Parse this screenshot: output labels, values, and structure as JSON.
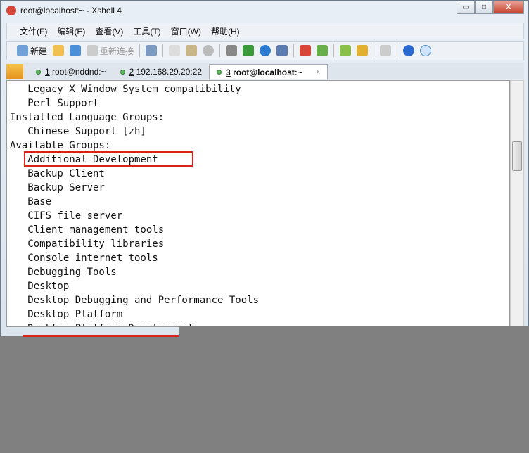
{
  "window": {
    "title": "root@localhost:~ - Xshell 4",
    "buttons": {
      "minimize": "▭",
      "maximize": "□",
      "close": "X"
    }
  },
  "menu": [
    "文件(F)",
    "编辑(E)",
    "查看(V)",
    "工具(T)",
    "窗口(W)",
    "帮助(H)"
  ],
  "toolbar": {
    "new_label": "新建",
    "reconnect_label": "重新连接"
  },
  "tabs": [
    {
      "num": "1",
      "label": " root@nddnd:~",
      "active": false
    },
    {
      "num": "2",
      "label": " 192.168.29.20:22",
      "active": false
    },
    {
      "num": "3",
      "label": " root@localhost:~",
      "active": true
    }
  ],
  "tab_close": "x",
  "terminal": {
    "lines": [
      "   Legacy X Window System compatibility",
      "   Perl Support",
      "Installed Language Groups:",
      "   Chinese Support [zh]",
      "Available Groups:",
      "   Additional Development",
      "   Backup Client",
      "   Backup Server",
      "   Base",
      "   CIFS file server",
      "   Client management tools",
      "   Compatibility libraries",
      "   Console internet tools",
      "   Debugging Tools",
      "   Desktop",
      "   Desktop Debugging and Performance Tools",
      "   Desktop Platform",
      "   Desktop Platform Development"
    ]
  },
  "colors": {
    "highlight": "#d9221c",
    "overlay": "#808080"
  }
}
